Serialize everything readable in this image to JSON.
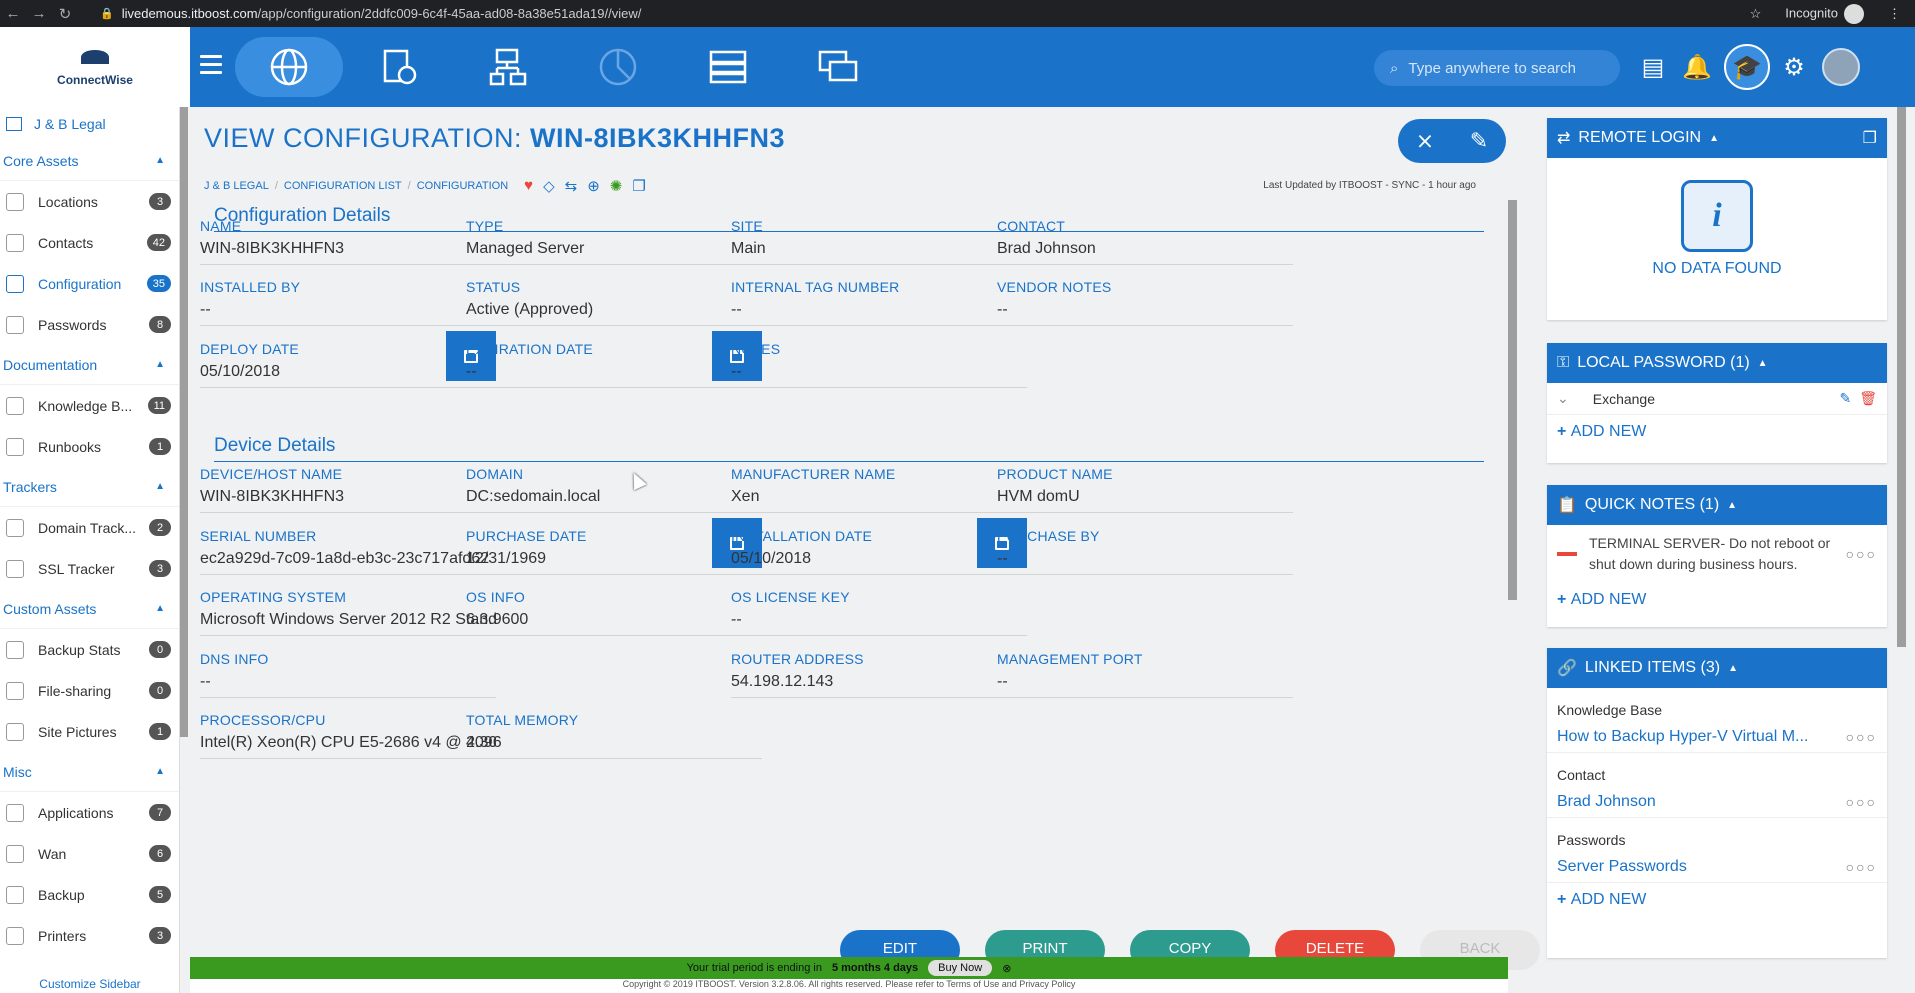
{
  "browser": {
    "url_host": "livedemous.itboost.com",
    "url_path": "/app/configuration/2ddfc009-6c4f-45aa-ad08-8a38e51ada19//view/",
    "mode": "Incognito"
  },
  "header": {
    "logo_text": "ConnectWise",
    "search_placeholder": "Type anywhere to search",
    "modules": [
      "globe-icon",
      "device-globe-icon",
      "sitemap-icon",
      "pie-chart-icon",
      "server-icon",
      "chat-icon"
    ]
  },
  "sidebar": {
    "company": "J & B Legal",
    "sections": [
      {
        "title": "Core Assets",
        "items": [
          {
            "label": "Locations",
            "count": "3"
          },
          {
            "label": "Contacts",
            "count": "42"
          },
          {
            "label": "Configuration",
            "count": "35",
            "active": true
          },
          {
            "label": "Passwords",
            "count": "8"
          }
        ]
      },
      {
        "title": "Documentation",
        "items": [
          {
            "label": "Knowledge B...",
            "count": "11"
          },
          {
            "label": "Runbooks",
            "count": "1"
          }
        ]
      },
      {
        "title": "Trackers",
        "items": [
          {
            "label": "Domain Track...",
            "count": "2"
          },
          {
            "label": "SSL Tracker",
            "count": "3"
          }
        ]
      },
      {
        "title": "Custom Assets",
        "items": [
          {
            "label": "Backup Stats",
            "count": "0"
          },
          {
            "label": "File-sharing",
            "count": "0"
          },
          {
            "label": "Site Pictures",
            "count": "1"
          }
        ]
      },
      {
        "title": "Misc",
        "items": [
          {
            "label": "Applications",
            "count": "7"
          },
          {
            "label": "Wan",
            "count": "6"
          },
          {
            "label": "Backup",
            "count": "5"
          },
          {
            "label": "Printers",
            "count": "3"
          }
        ]
      }
    ],
    "customize": "Customize Sidebar"
  },
  "main": {
    "title_prefix": "VIEW CONFIGURATION:",
    "title_name": "WIN-8IBK3KHHFN3",
    "breadcrumb": [
      "J & B LEGAL",
      "CONFIGURATION LIST",
      "CONFIGURATION"
    ],
    "last_updated": "Last Updated by ITBOOST - SYNC - 1 hour ago",
    "config_details": {
      "title": "Configuration Details",
      "fields": [
        {
          "label": "NAME",
          "value": "WIN-8IBK3KHHFN3"
        },
        {
          "label": "TYPE",
          "value": "Managed Server"
        },
        {
          "label": "SITE",
          "value": "Main"
        },
        {
          "label": "CONTACT",
          "value": "Brad Johnson"
        },
        {
          "label": "INSTALLED BY",
          "value": "--"
        },
        {
          "label": "STATUS",
          "value": "Active (Approved)"
        },
        {
          "label": "INTERNAL TAG NUMBER",
          "value": "--"
        },
        {
          "label": "VENDOR NOTES",
          "value": "--"
        },
        {
          "label": "DEPLOY DATE",
          "value": "05/10/2018"
        },
        {
          "label": "EXPIRATION DATE",
          "value": "--"
        },
        {
          "label": "NOTES",
          "value": "--"
        }
      ]
    },
    "device_details": {
      "title": "Device Details",
      "fields": [
        {
          "label": "DEVICE/HOST NAME",
          "value": "WIN-8IBK3KHHFN3"
        },
        {
          "label": "DOMAIN",
          "value": "DC:sedomain.local"
        },
        {
          "label": "MANUFACTURER NAME",
          "value": "Xen"
        },
        {
          "label": "PRODUCT NAME",
          "value": "HVM domU"
        },
        {
          "label": "SERIAL NUMBER",
          "value": "ec2a929d-7c09-1a8d-eb3c-23c717afd62"
        },
        {
          "label": "PURCHASE DATE",
          "value": "12/31/1969"
        },
        {
          "label": "INSTALLATION DATE",
          "value": "05/10/2018"
        },
        {
          "label": "PURCHASE BY",
          "value": "--"
        },
        {
          "label": "OPERATING SYSTEM",
          "value": "Microsoft Windows Server 2012 R2 Stand"
        },
        {
          "label": "OS INFO",
          "value": "6.3.9600"
        },
        {
          "label": "OS LICENSE KEY",
          "value": "--"
        },
        {
          "label": "DNS INFO",
          "value": "--"
        },
        {
          "label": "ROUTER ADDRESS",
          "value": "54.198.12.143"
        },
        {
          "label": "MANAGEMENT PORT",
          "value": "--"
        },
        {
          "label": "PROCESSOR/CPU",
          "value": "Intel(R) Xeon(R) CPU E5-2686 v4 @ 2.30G"
        },
        {
          "label": "TOTAL MEMORY",
          "value": "4096"
        }
      ]
    },
    "buttons": {
      "edit": "EDIT",
      "print": "PRINT",
      "copy": "COPY",
      "delete": "DELETE",
      "back": "BACK"
    },
    "trial": {
      "text": "Your trial period is ending in",
      "remaining": "5 months 4 days",
      "buy": "Buy Now"
    },
    "footer": "Copyright © 2019 ITBOOST. Version 3.2.8.06. All rights reserved. Please refer to Terms of Use and Privacy Policy"
  },
  "right_panels": {
    "remote_login": {
      "title": "REMOTE LOGIN",
      "empty": "NO DATA FOUND"
    },
    "local_password": {
      "title": "LOCAL PASSWORD (1)",
      "items": [
        "Exchange"
      ],
      "add": "ADD NEW"
    },
    "quick_notes": {
      "title": "QUICK NOTES (1)",
      "items": [
        "TERMINAL SERVER- Do not reboot or shut down during business hours."
      ],
      "add": "ADD NEW"
    },
    "linked_items": {
      "title": "LINKED ITEMS (3)",
      "groups": [
        {
          "type": "Knowledge Base",
          "item": "How to Backup Hyper-V Virtual M..."
        },
        {
          "type": "Contact",
          "item": "Brad Johnson"
        },
        {
          "type": "Passwords",
          "item": "Server Passwords"
        }
      ],
      "add": "ADD NEW"
    }
  },
  "colors": {
    "primary": "#1a73c9",
    "print": "#2e9b8f",
    "copy": "#2e9b8f",
    "delete": "#e8473b",
    "back": "#cfcfcf",
    "trial": "#3a9a1f"
  }
}
